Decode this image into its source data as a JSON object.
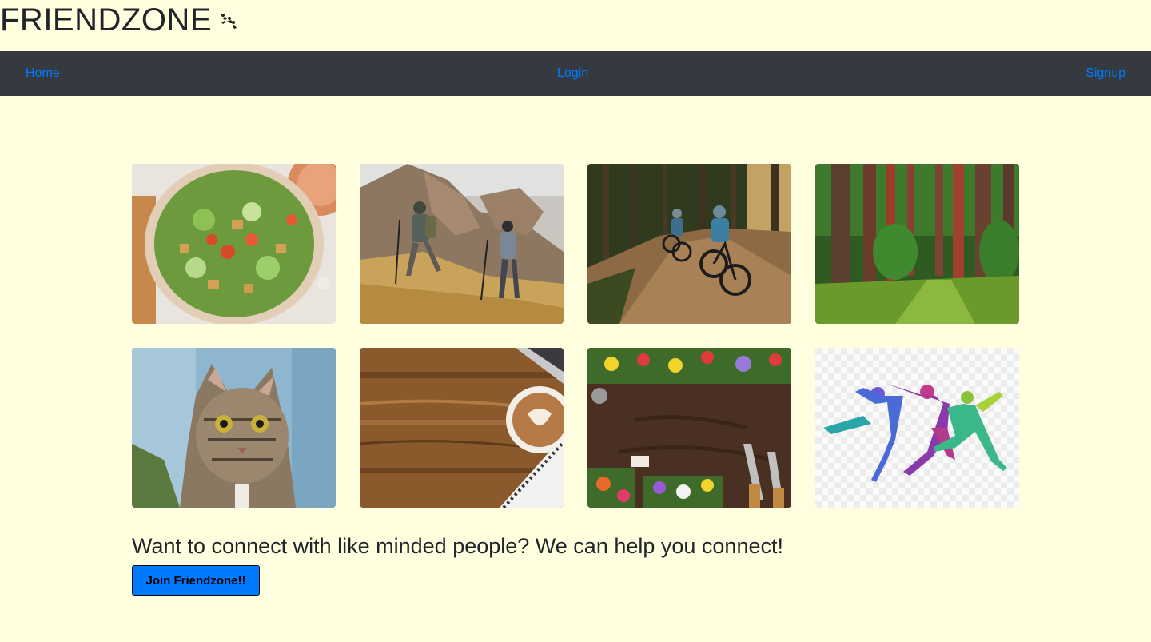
{
  "brand": {
    "title": "FRIENDZONE",
    "icon": "dancing-people-icon"
  },
  "nav": {
    "home": "Home",
    "login": "Login",
    "signup": "Signup"
  },
  "gallery": [
    {
      "name": "salad-photo"
    },
    {
      "name": "hikers-photo"
    },
    {
      "name": "cyclists-photo"
    },
    {
      "name": "forest-photo"
    },
    {
      "name": "cat-photo"
    },
    {
      "name": "coffee-desk-photo"
    },
    {
      "name": "gardening-photo"
    },
    {
      "name": "dancers-illustration"
    }
  ],
  "hero": {
    "tagline": "Want to connect with like minded people? We can help you connect!",
    "join_label": "Join Friendzone!!"
  },
  "colors": {
    "page_background": "#ffffe0",
    "navbar_background": "#343a40",
    "link": "#007bff",
    "button": "#007bff"
  }
}
